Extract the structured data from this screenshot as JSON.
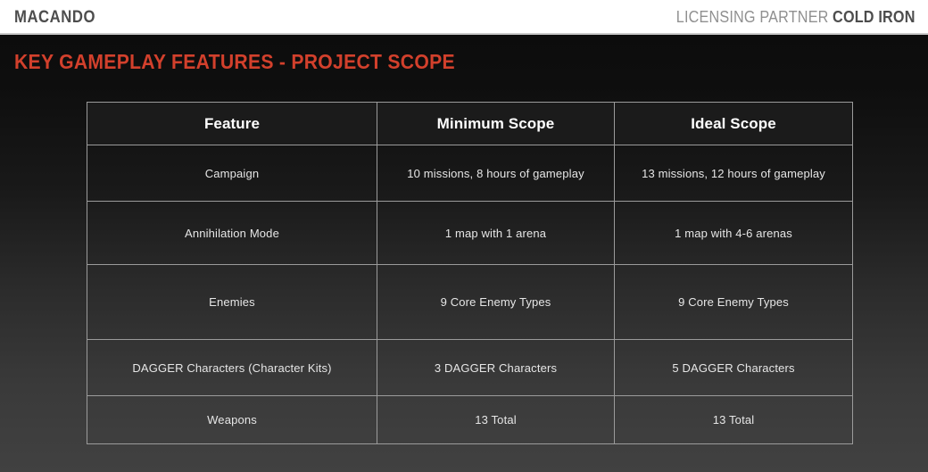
{
  "topbar": {
    "brand": "MACANDO",
    "partner_label": "LICENSING PARTNER",
    "partner_name": "COLD IRON"
  },
  "slide": {
    "title": "KEY GAMEPLAY FEATURES - PROJECT SCOPE",
    "title_color": "#d2402c",
    "background_top_color": "#0b0b0b",
    "background_bottom_color": "#414141"
  },
  "table": {
    "border_color": "#9b9b9b",
    "header_background": "#1b1b1b",
    "headers": [
      "Feature",
      "Minimum Scope",
      "Ideal Scope"
    ],
    "rows": [
      {
        "feature": "Campaign",
        "minimum": "10 missions, 8 hours of gameplay",
        "ideal": "13 missions, 12 hours of gameplay"
      },
      {
        "feature": "Annihilation Mode",
        "minimum": "1 map with 1 arena",
        "ideal": "1 map with 4-6 arenas"
      },
      {
        "feature": "Enemies",
        "minimum": "9 Core Enemy Types",
        "ideal": "9 Core Enemy Types"
      },
      {
        "feature": "DAGGER Characters (Character Kits)",
        "minimum": "3 DAGGER Characters",
        "ideal": "5 DAGGER Characters"
      },
      {
        "feature": "Weapons",
        "minimum": "13 Total",
        "ideal": "13 Total"
      }
    ]
  }
}
